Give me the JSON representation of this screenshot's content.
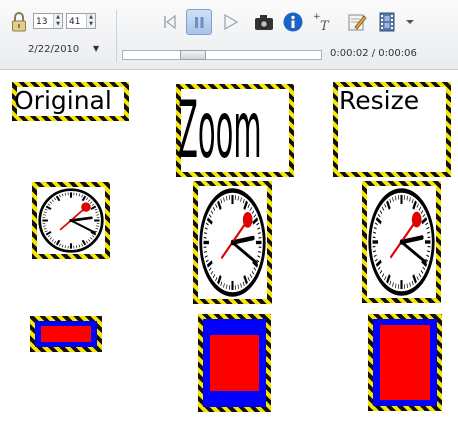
{
  "toolbar": {
    "spin_first": "13",
    "spin_second": "41",
    "date_value": "2/22/2010",
    "time_readout": "0:00:02 / 0:00:06",
    "playback_position": 0.33,
    "icons": [
      "lock-icon",
      "skip-back-icon",
      "pause-icon",
      "play-icon",
      "camera-icon",
      "info-icon",
      "add-text-icon",
      "edit-icon",
      "film-icon",
      "chevron-down-icon"
    ]
  },
  "canvas": {
    "label_original": "Original",
    "label_zoom": "Zoom",
    "label_resize": "Resize",
    "colors": {
      "hazard_black": "#111111",
      "hazard_yellow": "#f8e600",
      "rect_blue": "#0000ff",
      "rect_red": "#ff0000",
      "clock_hand_red": "#e00000"
    }
  }
}
